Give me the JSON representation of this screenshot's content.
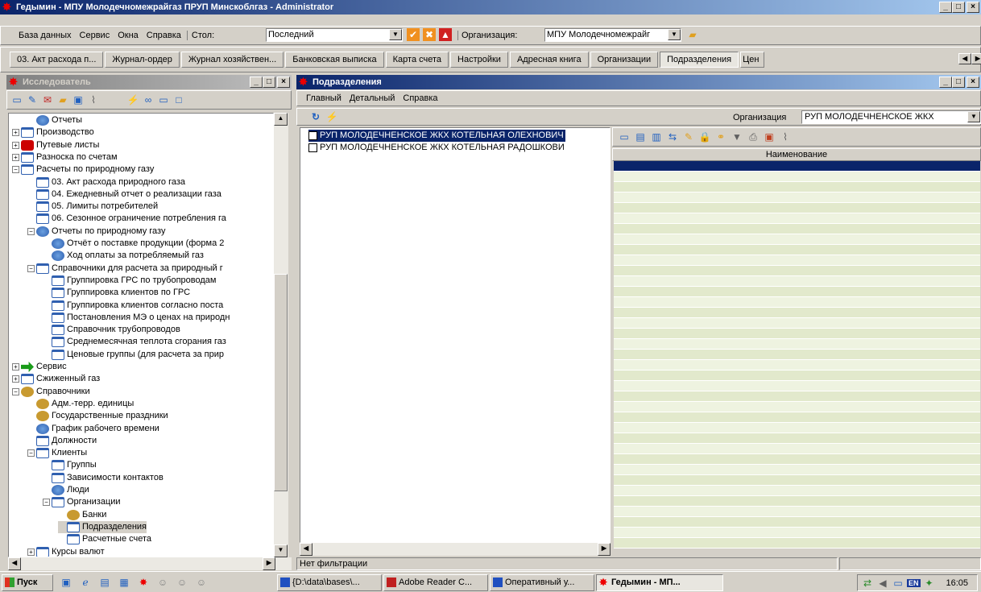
{
  "app": {
    "title": "Гедымин - МПУ Молодечномежрайгаз ПРУП Минскоблгаз - Administrator",
    "icon": "gedymin-logo-icon"
  },
  "main_menu": [
    "База данных",
    "Сервис",
    "Окна",
    "Справка"
  ],
  "stol": {
    "label": "Стол:",
    "value": "Последний"
  },
  "org_top": {
    "label": "Организация:",
    "value": "МПУ Молодечномежрайг"
  },
  "tabs": [
    "03. Акт расхода п...",
    "Журнал-ордер",
    "Журнал хозяйствен...",
    "Банковская выписка",
    "Карта счета",
    "Настройки",
    "Адресная книга",
    "Организации",
    "Подразделения",
    "Цен"
  ],
  "active_tab": "Подразделения",
  "explorer": {
    "title": "Исследователь"
  },
  "tree": [
    {
      "label": "Отчеты",
      "depth": 1,
      "icon": "report",
      "exp": ""
    },
    {
      "label": "Производство",
      "depth": 0,
      "icon": "folder",
      "exp": "+"
    },
    {
      "label": "Путевые листы",
      "depth": 0,
      "icon": "red",
      "exp": "+"
    },
    {
      "label": "Разноска по счетам",
      "depth": 0,
      "icon": "folder",
      "exp": "+"
    },
    {
      "label": "Расчеты по природному газу",
      "depth": 0,
      "icon": "folder",
      "exp": "-"
    },
    {
      "label": "03. Акт расхода природного газа",
      "depth": 1,
      "icon": "folder",
      "exp": ""
    },
    {
      "label": "04. Ежедневный отчет о реализации газа",
      "depth": 1,
      "icon": "folder",
      "exp": ""
    },
    {
      "label": "05. Лимиты потребителей",
      "depth": 1,
      "icon": "folder",
      "exp": ""
    },
    {
      "label": "06. Сезонное ограничение потребления га",
      "depth": 1,
      "icon": "folder",
      "exp": ""
    },
    {
      "label": "Отчеты по природному газу",
      "depth": 1,
      "icon": "report",
      "exp": "-"
    },
    {
      "label": "Отчёт о поставке продукции (форма 2",
      "depth": 2,
      "icon": "report",
      "exp": ""
    },
    {
      "label": "Ход оплаты за потребляемый газ",
      "depth": 2,
      "icon": "report",
      "exp": ""
    },
    {
      "label": "Справочники для расчета за природный г",
      "depth": 1,
      "icon": "folder",
      "exp": "-"
    },
    {
      "label": "Группировка ГРС по трубопроводам",
      "depth": 2,
      "icon": "folder",
      "exp": ""
    },
    {
      "label": "Группировка клиентов по ГРС",
      "depth": 2,
      "icon": "folder",
      "exp": ""
    },
    {
      "label": "Группировка клиентов согласно поста",
      "depth": 2,
      "icon": "folder",
      "exp": ""
    },
    {
      "label": "Постановления МЭ о ценах на природн",
      "depth": 2,
      "icon": "folder",
      "exp": ""
    },
    {
      "label": "Справочник трубопроводов",
      "depth": 2,
      "icon": "folder",
      "exp": ""
    },
    {
      "label": "Среднемесячная теплота сгорания газ",
      "depth": 2,
      "icon": "folder",
      "exp": ""
    },
    {
      "label": "Ценовые группы (для расчета за прир",
      "depth": 2,
      "icon": "folder",
      "exp": ""
    },
    {
      "label": "Сервис",
      "depth": 0,
      "icon": "green",
      "exp": "+"
    },
    {
      "label": "Сжиженный газ",
      "depth": 0,
      "icon": "folder",
      "exp": "+"
    },
    {
      "label": "Справочники",
      "depth": 0,
      "icon": "gold",
      "exp": "-"
    },
    {
      "label": "Адм.-терр. единицы",
      "depth": 1,
      "icon": "gold",
      "exp": ""
    },
    {
      "label": "Государственные праздники",
      "depth": 1,
      "icon": "gold",
      "exp": ""
    },
    {
      "label": "График рабочего времени",
      "depth": 1,
      "icon": "report",
      "exp": ""
    },
    {
      "label": "Должности",
      "depth": 1,
      "icon": "folder",
      "exp": ""
    },
    {
      "label": "Клиенты",
      "depth": 1,
      "icon": "folder",
      "exp": "-"
    },
    {
      "label": "Группы",
      "depth": 2,
      "icon": "folder",
      "exp": ""
    },
    {
      "label": "Зависимости контактов",
      "depth": 2,
      "icon": "folder",
      "exp": ""
    },
    {
      "label": "Люди",
      "depth": 2,
      "icon": "report",
      "exp": ""
    },
    {
      "label": "Организации",
      "depth": 2,
      "icon": "folder",
      "exp": "-"
    },
    {
      "label": "Банки",
      "depth": 3,
      "icon": "gold",
      "exp": ""
    },
    {
      "label": "Подразделения",
      "depth": 3,
      "icon": "folder",
      "exp": "",
      "selected": true
    },
    {
      "label": "Расчетные счета",
      "depth": 3,
      "icon": "folder",
      "exp": ""
    },
    {
      "label": "Курсы валют",
      "depth": 1,
      "icon": "folder",
      "exp": "+"
    }
  ],
  "sub": {
    "title": "Подразделения",
    "menu": [
      "Главный",
      "Детальный",
      "Справка"
    ],
    "org_label": "Организация",
    "org_value": "РУП МОЛОДЕЧНЕНСКОЕ ЖКХ",
    "items": [
      "РУП МОЛОДЕЧНЕНСКОЕ ЖКХ КОТЕЛЬНАЯ ОЛЕХНОВИЧ",
      "РУП МОЛОДЕЧНЕНСКОЕ ЖКХ КОТЕЛЬНАЯ РАДОШКОВИ"
    ],
    "grid_header": "Наименование",
    "status": "Нет фильтрации"
  },
  "taskbar": {
    "start": "Пуск",
    "tasks": [
      "{D:\\data\\bases\\...",
      "Adobe Reader C...",
      "Оперативный у...",
      "Гедымин - МП..."
    ],
    "lang": "EN",
    "clock": "16:05"
  }
}
